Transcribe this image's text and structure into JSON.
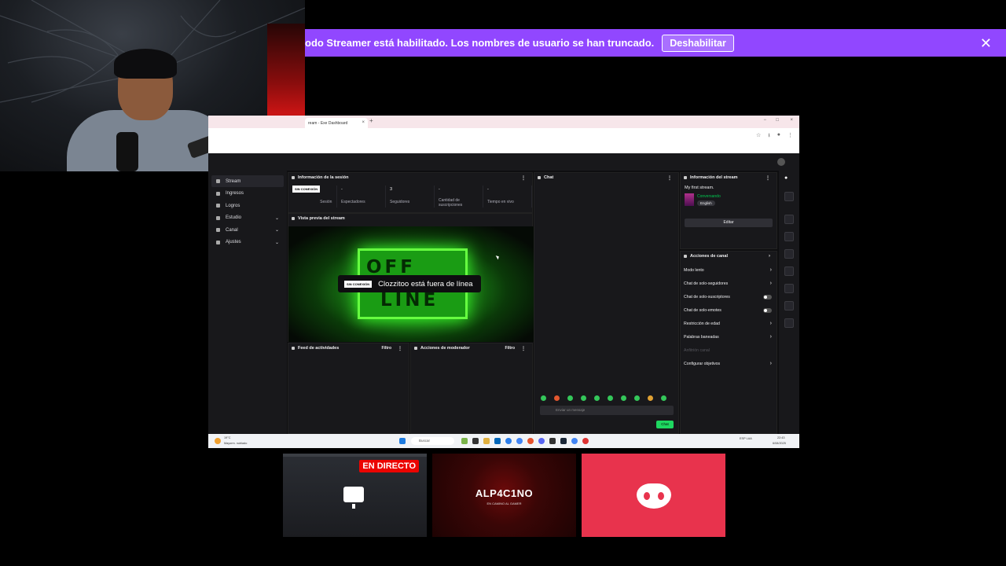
{
  "banner": {
    "text": "odo Streamer está habilitado. Los nombres de usuario se han truncado.",
    "button": "Deshabilitar",
    "close_icon": "close-icon"
  },
  "browser": {
    "tab_title": "ream - Exe Dashboard",
    "new_tab": "+",
    "window_controls": [
      "−",
      "□",
      "×"
    ]
  },
  "nav": {
    "items": [
      {
        "label": "Stream",
        "active": true,
        "chevron": false
      },
      {
        "label": "Ingresos",
        "active": false,
        "chevron": false
      },
      {
        "label": "Logros",
        "active": false,
        "chevron": false
      },
      {
        "label": "Estudio",
        "active": false,
        "chevron": true
      },
      {
        "label": "Canal",
        "active": false,
        "chevron": true
      },
      {
        "label": "Ajustes",
        "active": false,
        "chevron": true
      }
    ]
  },
  "session": {
    "title": "Información de la sesión",
    "badge": "SIN CONEXIÓN",
    "session_label": "Sesión",
    "stats": [
      {
        "value": "-",
        "label": "Espectadores"
      },
      {
        "value": "3",
        "label": "Seguidores"
      },
      {
        "value": "-",
        "label": "Cantidad de suscripciones"
      },
      {
        "value": "-",
        "label": "Tiempo en vivo"
      }
    ]
  },
  "preview": {
    "title": "Vista previa del stream",
    "board_top": "OFF",
    "board_bottom": "LINE",
    "badge": "SIN CONEXIÓN",
    "message": "Clozzitoo está fuera de línea"
  },
  "activity": {
    "title": "Feed de actividades",
    "filter": "Filtro"
  },
  "mod": {
    "title": "Acciones de moderador",
    "filter": "Filtro"
  },
  "chat": {
    "title": "Chat",
    "placeholder": "Enviar un mensaje",
    "button": "Chat"
  },
  "stream_info": {
    "title": "Información del stream",
    "stream_title": "My first stream.",
    "category": "Conversando",
    "language": "English",
    "edit": "Editar"
  },
  "channel_actions": {
    "title": "Acciones de canal",
    "items": [
      {
        "label": "Modo lento",
        "type": "chevron"
      },
      {
        "label": "Chat de solo-seguidores",
        "type": "chevron"
      },
      {
        "label": "Chat de solo-suscriptores",
        "type": "toggle"
      },
      {
        "label": "Chat de solo-emotes",
        "type": "toggle"
      },
      {
        "label": "Restricción de edad",
        "type": "chevron"
      },
      {
        "label": "Palabras baneadas",
        "type": "chevron"
      },
      {
        "label": "Anfitrión canal",
        "type": "dim"
      },
      {
        "label": "Configurar objetivos",
        "type": "chevron"
      }
    ]
  },
  "taskbar": {
    "search": "Buscar",
    "weather_temp": "19°C",
    "weather_text": "Mayorm. nublado",
    "lang": "ESP LAA",
    "time": "22:43",
    "date": "6/08/2025"
  },
  "cards": {
    "live": "EN DIRECTO",
    "alp": "ALP4C1NO",
    "alp_sub": "EN CAMINO AL GAMER"
  },
  "colors": {
    "banner": "#9147ff",
    "discord": "#e8334d",
    "live": "#eb0400",
    "offline_green": "#3cd92a"
  }
}
